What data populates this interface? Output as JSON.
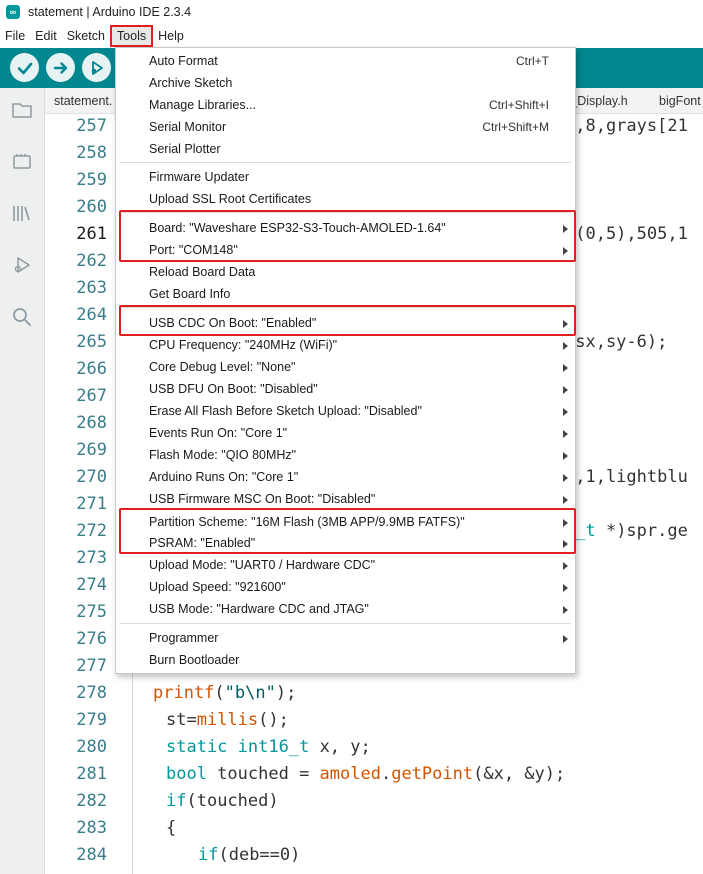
{
  "window": {
    "title": "statement | Arduino IDE 2.3.4",
    "app_icon_glyph": "∞"
  },
  "menubar": {
    "items": [
      "File",
      "Edit",
      "Sketch",
      "Tools",
      "Help"
    ],
    "active": "Tools"
  },
  "toolbar": {
    "verify_label": "Verify",
    "upload_label": "Upload",
    "debug_label": "Debug",
    "accent": "#00878f"
  },
  "tabs": [
    "statement.",
    "s_Display.h",
    "bigFont"
  ],
  "editor": {
    "line_numbers": [
      "257",
      "258",
      "259",
      "260",
      "261",
      "262",
      "263",
      "264",
      "265",
      "266",
      "267",
      "268",
      "269",
      "270",
      "271",
      "272",
      "273",
      "274",
      "275",
      "276",
      "277",
      "278",
      "279",
      "280",
      "281",
      "282",
      "283",
      "284"
    ],
    "current_line": "261",
    "visible_fragments": {
      "l257": "1,8,grays[21",
      "l261": "g(0,5),505,1",
      "l265": ",sx,sy-6);",
      "l270": "1,1,lightblu",
      "l272_a": "6_t ",
      "l272_b": "*)spr.ge"
    },
    "code_lines": {
      "l278": {
        "fn": "printf",
        "rest_open": "(",
        "str": "\"b\\n\"",
        "rest_close": ");"
      },
      "l279": {
        "pre": "st=",
        "fn": "millis",
        "post": "();"
      },
      "l280": {
        "kw1": "static",
        "kw2": "int16_t",
        "post": " x, y;"
      },
      "l281": {
        "kw": "bool",
        "mid": " touched = ",
        "obj": "amoled",
        "dot": ".",
        "fn": "getPoint",
        "post": "(&x, &y);"
      },
      "l282": {
        "kw": "if",
        "post": "(touched)"
      },
      "l283": {
        "text": "{"
      },
      "l284": {
        "kw": "if",
        "post": "(deb==0)"
      }
    }
  },
  "tools_menu": {
    "items": [
      {
        "label": "Auto Format",
        "shortcut": "Ctrl+T",
        "submenu": false
      },
      {
        "label": "Archive Sketch",
        "shortcut": "",
        "submenu": false
      },
      {
        "label": "Manage Libraries...",
        "shortcut": "Ctrl+Shift+I",
        "submenu": false
      },
      {
        "label": "Serial Monitor",
        "shortcut": "Ctrl+Shift+M",
        "submenu": false
      },
      {
        "label": "Serial Plotter",
        "shortcut": "",
        "submenu": false
      },
      {
        "label": "Firmware Updater",
        "shortcut": "",
        "submenu": false
      },
      {
        "label": "Upload SSL Root Certificates",
        "shortcut": "",
        "submenu": false
      },
      {
        "label": "Board: \"Waveshare ESP32-S3-Touch-AMOLED-1.64\"",
        "shortcut": "",
        "submenu": true
      },
      {
        "label": "Port: \"COM148\"",
        "shortcut": "",
        "submenu": true
      },
      {
        "label": "Reload Board Data",
        "shortcut": "",
        "submenu": false
      },
      {
        "label": "Get Board Info",
        "shortcut": "",
        "submenu": false
      },
      {
        "label": "USB CDC On Boot: \"Enabled\"",
        "shortcut": "",
        "submenu": true
      },
      {
        "label": "CPU Frequency: \"240MHz (WiFi)\"",
        "shortcut": "",
        "submenu": true
      },
      {
        "label": "Core Debug Level: \"None\"",
        "shortcut": "",
        "submenu": true
      },
      {
        "label": "USB DFU On Boot: \"Disabled\"",
        "shortcut": "",
        "submenu": true
      },
      {
        "label": "Erase All Flash Before Sketch Upload: \"Disabled\"",
        "shortcut": "",
        "submenu": true
      },
      {
        "label": "Events Run On: \"Core 1\"",
        "shortcut": "",
        "submenu": true
      },
      {
        "label": "Flash Mode: \"QIO 80MHz\"",
        "shortcut": "",
        "submenu": true
      },
      {
        "label": "Arduino Runs On: \"Core 1\"",
        "shortcut": "",
        "submenu": true
      },
      {
        "label": "USB Firmware MSC On Boot: \"Disabled\"",
        "shortcut": "",
        "submenu": true
      },
      {
        "label": "Partition Scheme: \"16M Flash (3MB APP/9.9MB FATFS)\"",
        "shortcut": "",
        "submenu": true
      },
      {
        "label": "PSRAM: \"Enabled\"",
        "shortcut": "",
        "submenu": true
      },
      {
        "label": "Upload Mode: \"UART0 / Hardware CDC\"",
        "shortcut": "",
        "submenu": true
      },
      {
        "label": "Upload Speed: \"921600\"",
        "shortcut": "",
        "submenu": true
      },
      {
        "label": "USB Mode: \"Hardware CDC and JTAG\"",
        "shortcut": "",
        "submenu": true
      },
      {
        "label": "Programmer",
        "shortcut": "",
        "submenu": true
      },
      {
        "label": "Burn Bootloader",
        "shortcut": "",
        "submenu": false
      }
    ]
  },
  "colors": {
    "highlight_box": "#e02020",
    "teal": "#00979c",
    "line_number": "#3a7d8a"
  }
}
